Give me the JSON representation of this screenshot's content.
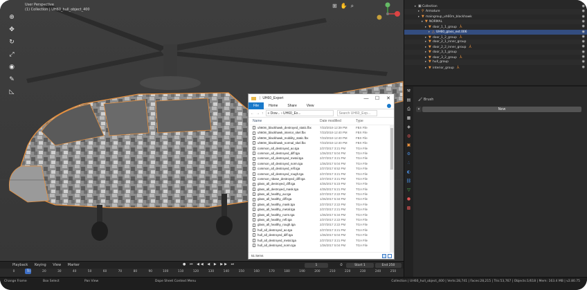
{
  "viewport": {
    "header_line1": "User Perspective",
    "header_line2": "(1) Collection | UH60_hull_object_400"
  },
  "explorer": {
    "title": "UH60_Export",
    "window_buttons": [
      "—",
      "☐",
      "✕"
    ],
    "ribbon_tabs": [
      "File",
      "Home",
      "Share",
      "View"
    ],
    "address_path": "« Dow... › UH60_Ex...",
    "search_placeholder": "Search UH60_Exp...",
    "columns": [
      "Name",
      "Date modified",
      "Type"
    ],
    "files": [
      {
        "name": "uh60m_blackhawk_destroyed_static.fbx",
        "date": "7/23/2019 12:39 PM",
        "type": "FBX File"
      },
      {
        "name": "uh60m_blackhawk_interior_skel.fbx",
        "date": "7/23/2019 12:40 PM",
        "type": "FBX File"
      },
      {
        "name": "uh60m_blackhawk_mobility_static.fbx",
        "date": "7/23/2019 12:40 PM",
        "type": "FBX File"
      },
      {
        "name": "uh60m_blackhawk_normal_skel.fbx",
        "date": "7/23/2019 12:40 PM",
        "type": "FBX File"
      },
      {
        "name": "common_all_destroyed_ao.tga",
        "date": "2/27/2017 3:21 PM",
        "type": "TGA File"
      },
      {
        "name": "common_all_destroyed_diff.tga",
        "date": "1/26/2017 5:04 PM",
        "type": "TGA File"
      },
      {
        "name": "common_all_destroyed_metal.tga",
        "date": "2/27/2017 3:21 PM",
        "type": "TGA File"
      },
      {
        "name": "common_all_destroyed_norm.tga",
        "date": "1/26/2017 5:04 PM",
        "type": "TGA File"
      },
      {
        "name": "common_all_destroyed_refl.tga",
        "date": "2/27/2017 8:52 PM",
        "type": "TGA File"
      },
      {
        "name": "common_all_destroyed_rough.tga",
        "date": "2/27/2017 3:21 PM",
        "type": "TGA File"
      },
      {
        "name": "common_nbase_destroyed_diff.tga",
        "date": "2/27/2017 3:21 PM",
        "type": "TGA File"
      },
      {
        "name": "glass_all_destroyed_diff.tga",
        "date": "4/25/2017 5:23 PM",
        "type": "TGA File"
      },
      {
        "name": "glass_all_destroyed_mask.tga",
        "date": "4/25/2017 5:21 PM",
        "type": "TGA File"
      },
      {
        "name": "glass_all_healthy_ao.tga",
        "date": "2/27/2017 2:22 PM",
        "type": "TGA File"
      },
      {
        "name": "glass_all_healthy_diff.tga",
        "date": "1/26/2017 5:34 PM",
        "type": "TGA File"
      },
      {
        "name": "glass_all_healthy_mask.tga",
        "date": "2/27/2017 2:22 PM",
        "type": "TGA File"
      },
      {
        "name": "glass_all_healthy_metal.tga",
        "date": "2/27/2017 2:21 PM",
        "type": "TGA File"
      },
      {
        "name": "glass_all_healthy_norm.tga",
        "date": "1/26/2017 5:34 PM",
        "type": "TGA File"
      },
      {
        "name": "glass_all_healthy_refl.tga",
        "date": "2/27/2017 2:22 PM",
        "type": "TGA File"
      },
      {
        "name": "glass_all_healthy_rough.tga",
        "date": "2/27/2017 2:22 PM",
        "type": "TGA File"
      },
      {
        "name": "hull_all_destroyed_ao.tga",
        "date": "2/27/2017 3:21 PM",
        "type": "TGA File"
      },
      {
        "name": "hull_all_destroyed_diff.tga",
        "date": "1/26/2017 5:04 PM",
        "type": "TGA File"
      },
      {
        "name": "hull_all_destroyed_metal.tga",
        "date": "2/27/2017 3:21 PM",
        "type": "TGA File"
      },
      {
        "name": "hull_all_destroyed_norm.tga",
        "date": "1/26/2017 5:04 PM",
        "type": "TGA File"
      }
    ],
    "status": "51 items"
  },
  "outliner": {
    "rows": [
      {
        "label": "Collection",
        "indent": 1,
        "icon": "collection-icon"
      },
      {
        "label": "Armature",
        "indent": 2,
        "icon": "armature-icon"
      },
      {
        "label": "maingroup_uh60m_blackhawk",
        "indent": 2,
        "icon": "object-icon"
      },
      {
        "label": "NORMAL",
        "indent": 3,
        "icon": "object-icon"
      },
      {
        "label": "door_1_1_group",
        "indent": 4,
        "icon": "object-icon"
      },
      {
        "label": "UH60_glass_ext.006",
        "indent": 5,
        "icon": "mesh-icon",
        "selected": true
      },
      {
        "label": "door_1_2_group",
        "indent": 4,
        "icon": "object-icon"
      },
      {
        "label": "door_2_1_inner_group",
        "indent": 4,
        "icon": "object-icon"
      },
      {
        "label": "door_2_2_inner_group",
        "indent": 4,
        "icon": "object-icon"
      },
      {
        "label": "door_3_1_group",
        "indent": 4,
        "icon": "object-icon"
      },
      {
        "label": "door_3_2_group",
        "indent": 4,
        "icon": "object-icon"
      },
      {
        "label": "hull_group",
        "indent": 4,
        "icon": "object-icon"
      },
      {
        "label": "interior_group",
        "indent": 4,
        "icon": "object-icon"
      }
    ]
  },
  "properties": {
    "brush_label": "Brush",
    "new_button": "New"
  },
  "timeline": {
    "menus": [
      "Playback",
      "Keying",
      "View",
      "Marker"
    ],
    "current_frame": "1",
    "start_label": "Start",
    "start_value": "1",
    "end_label": "End",
    "end_value": "250",
    "frame_field": "1",
    "ticks": [
      "0",
      "10",
      "20",
      "30",
      "40",
      "50",
      "60",
      "70",
      "80",
      "90",
      "100",
      "110",
      "120",
      "130",
      "140",
      "150",
      "160",
      "170",
      "180",
      "190",
      "200",
      "210",
      "220",
      "230",
      "240",
      "250"
    ]
  },
  "statusbar": {
    "items": [
      "Change Frame",
      "Box Select",
      "Pan View",
      "Dope Sheet Context Menu"
    ],
    "stats": "Collection | UH60_hull_object_400 | Verts:28,741 | Faces:28,215 | Tris:53,767 | Objects:1/618 | Mem: 163.4 MB | v2.80.75"
  },
  "colors": {
    "accent_blue": "#1979ca",
    "blender_orange": "#e8913e",
    "selection": "#334d80"
  }
}
